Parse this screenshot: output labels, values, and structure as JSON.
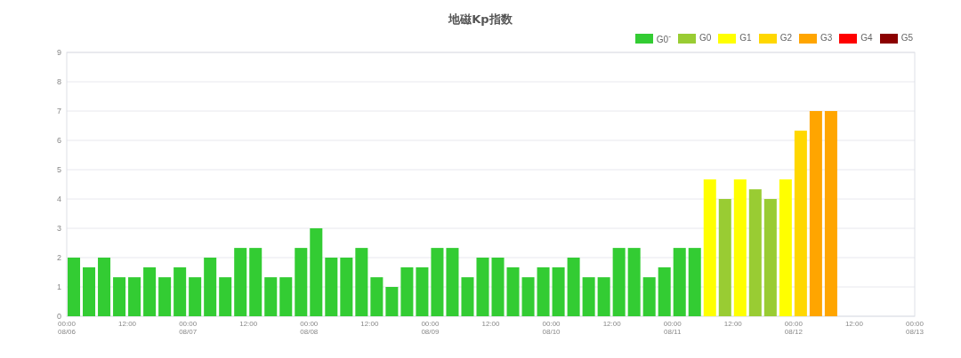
{
  "title": "地磁Kp指数",
  "chart_data": {
    "type": "bar",
    "grid": true,
    "legend": true,
    "ylim": [
      0,
      9
    ],
    "yticks": [
      0,
      1,
      2,
      3,
      4,
      5,
      6,
      7,
      8,
      9
    ],
    "categories": [
      "00:00\n08/06",
      null,
      null,
      null,
      "12:00",
      null,
      null,
      null,
      "00:00\n08/07",
      null,
      null,
      null,
      "12:00",
      null,
      null,
      null,
      "00:00\n08/08",
      null,
      null,
      null,
      "12:00",
      null,
      null,
      null,
      "00:00\n08/09",
      null,
      null,
      null,
      "12:00",
      null,
      null,
      null,
      "00:00\n08/10",
      null,
      null,
      null,
      "12:00",
      null,
      null,
      null,
      "00:00\n08/11",
      null,
      null,
      null,
      "12:00",
      null,
      null,
      null,
      "00:00\n08/12",
      null,
      null,
      null,
      "12:00",
      null,
      null,
      null,
      "00:00\n08/13"
    ],
    "series": [
      {
        "name": "G0$^{-}$",
        "color": "#33cc33",
        "values": [
          2,
          1.67,
          2,
          1.33,
          1.33,
          1.67,
          1.33,
          1.67,
          1.33,
          2,
          1.33,
          2.33,
          2.33,
          1.33,
          1.33,
          2.33,
          3,
          2,
          2,
          2.33,
          1.33,
          1,
          1.67,
          1.67,
          2.33,
          2.33,
          1.33,
          2,
          2,
          1.67,
          1.33,
          1.67,
          1.67,
          2,
          1.33,
          1.33,
          2.33,
          2.33,
          1.33,
          1.67,
          2.33,
          2.33,
          null,
          null,
          null,
          null,
          null,
          null,
          null,
          null,
          null,
          null,
          null,
          null,
          null,
          null,
          null
        ]
      },
      {
        "name": "G0",
        "color": "#99cc33",
        "values": [
          null,
          null,
          null,
          null,
          null,
          null,
          null,
          null,
          null,
          null,
          null,
          null,
          null,
          null,
          null,
          null,
          null,
          null,
          null,
          null,
          null,
          null,
          null,
          null,
          null,
          null,
          null,
          null,
          null,
          null,
          null,
          null,
          null,
          null,
          null,
          null,
          null,
          null,
          null,
          null,
          null,
          null,
          null,
          4,
          null,
          4.33,
          4,
          null,
          null,
          null,
          null,
          null,
          null,
          null,
          null,
          null,
          null
        ]
      },
      {
        "name": "G1",
        "color": "#ffff00",
        "values": [
          null,
          null,
          null,
          null,
          null,
          null,
          null,
          null,
          null,
          null,
          null,
          null,
          null,
          null,
          null,
          null,
          null,
          null,
          null,
          null,
          null,
          null,
          null,
          null,
          null,
          null,
          null,
          null,
          null,
          null,
          null,
          null,
          null,
          null,
          null,
          null,
          null,
          null,
          null,
          null,
          null,
          null,
          4.67,
          null,
          4.67,
          null,
          null,
          4.67,
          null,
          null,
          null,
          null,
          null,
          null,
          null,
          null,
          null
        ]
      },
      {
        "name": "G2",
        "color": "#ffd700",
        "values": [
          null,
          null,
          null,
          null,
          null,
          null,
          null,
          null,
          null,
          null,
          null,
          null,
          null,
          null,
          null,
          null,
          null,
          null,
          null,
          null,
          null,
          null,
          null,
          null,
          null,
          null,
          null,
          null,
          null,
          null,
          null,
          null,
          null,
          null,
          null,
          null,
          null,
          null,
          null,
          null,
          null,
          null,
          null,
          null,
          null,
          null,
          null,
          null,
          6.33,
          null,
          null,
          null,
          null,
          null,
          null,
          null,
          null
        ]
      },
      {
        "name": "G3",
        "color": "#ffa500",
        "values": [
          null,
          null,
          null,
          null,
          null,
          null,
          null,
          null,
          null,
          null,
          null,
          null,
          null,
          null,
          null,
          null,
          null,
          null,
          null,
          null,
          null,
          null,
          null,
          null,
          null,
          null,
          null,
          null,
          null,
          null,
          null,
          null,
          null,
          null,
          null,
          null,
          null,
          null,
          null,
          null,
          null,
          null,
          null,
          null,
          null,
          null,
          null,
          null,
          null,
          7,
          7,
          null,
          null,
          null,
          null,
          null,
          null
        ]
      },
      {
        "name": "G4",
        "color": "#ff0000",
        "values": [
          null,
          null,
          null,
          null,
          null,
          null,
          null,
          null,
          null,
          null,
          null,
          null,
          null,
          null,
          null,
          null,
          null,
          null,
          null,
          null,
          null,
          null,
          null,
          null,
          null,
          null,
          null,
          null,
          null,
          null,
          null,
          null,
          null,
          null,
          null,
          null,
          null,
          null,
          null,
          null,
          null,
          null,
          null,
          null,
          null,
          null,
          null,
          null,
          null,
          null,
          null,
          null,
          null,
          null,
          null,
          null,
          null
        ]
      },
      {
        "name": "G5",
        "color": "#8b0000",
        "values": [
          null,
          null,
          null,
          null,
          null,
          null,
          null,
          null,
          null,
          null,
          null,
          null,
          null,
          null,
          null,
          null,
          null,
          null,
          null,
          null,
          null,
          null,
          null,
          null,
          null,
          null,
          null,
          null,
          null,
          null,
          null,
          null,
          null,
          null,
          null,
          null,
          null,
          null,
          null,
          null,
          null,
          null,
          null,
          null,
          null,
          null,
          null,
          null,
          null,
          null,
          null,
          null,
          null,
          null,
          null,
          null,
          null
        ]
      }
    ]
  }
}
